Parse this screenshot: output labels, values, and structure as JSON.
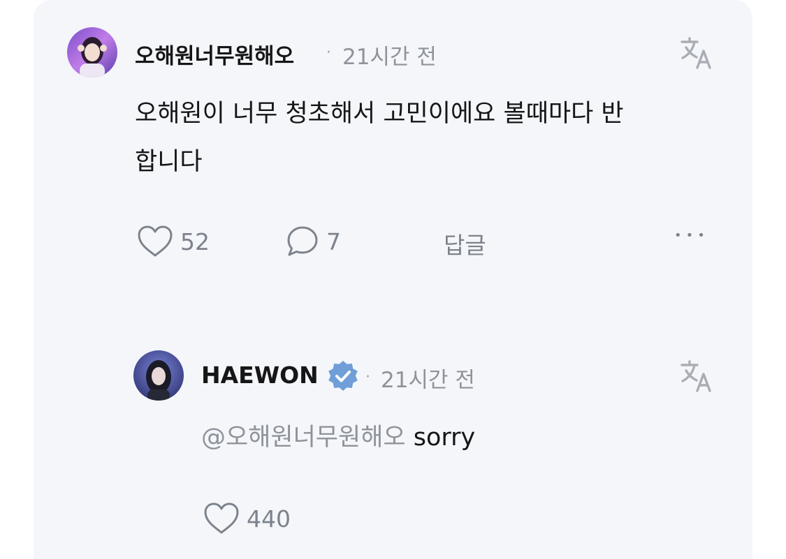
{
  "comment": {
    "author": "오해원너무원해오",
    "separator": "·",
    "time": "21시간 전",
    "text_line1": "오해원이 너무 청초해서 고민이에요 볼때마다 반",
    "text_line2": "합니다",
    "likes": "52",
    "replies": "7",
    "reply_label": "답글",
    "more_label": "•••"
  },
  "reply": {
    "author": "HAEWON",
    "verified": true,
    "separator": "·",
    "time": "21시간 전",
    "mention": "@오해원너무원해오",
    "text": " sorry",
    "likes": "440"
  },
  "icons": {
    "like": "heart-icon",
    "comment": "comment-bubble-icon",
    "translate": "translate-icon",
    "verified": "verified-badge-icon",
    "more": "more-horizontal-icon"
  },
  "colors": {
    "card_background": "#f4f6fa",
    "text_primary": "#161616",
    "text_secondary": "#8e939b",
    "verified_badge": "#6f9ed8"
  }
}
